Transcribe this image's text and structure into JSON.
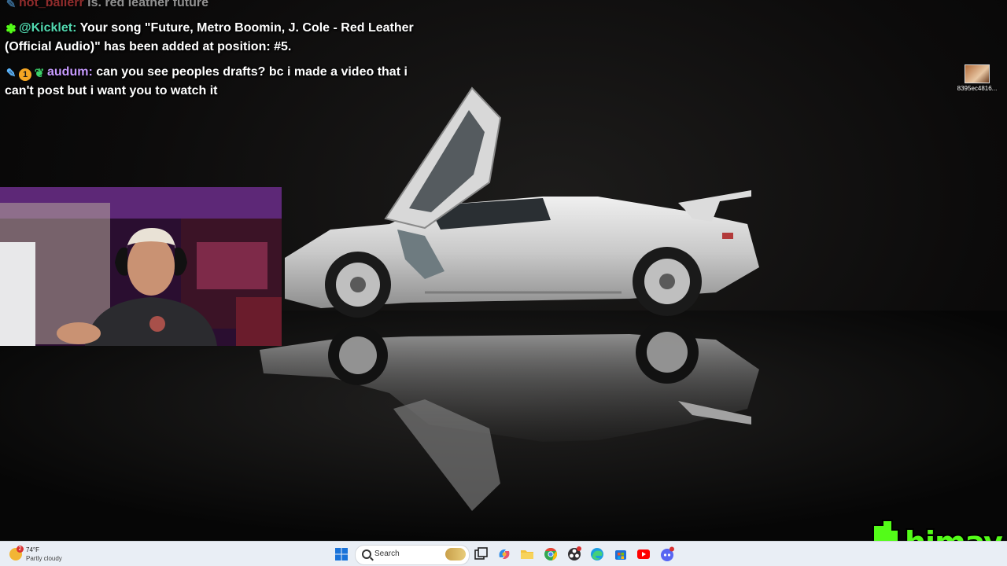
{
  "chat": {
    "messages": [
      {
        "user": "hot_ballerr",
        "text": "is. red leather future"
      },
      {
        "user": "@Kicklet:",
        "text": "Your song \"Future, Metro Boomin, J. Cole - Red Leather (Official Audio)\" has been added at position: #5."
      },
      {
        "user": "audum:",
        "text": "can you see peoples drafts? bc i made a video that i can't post but i want you to watch it"
      }
    ]
  },
  "desktop": {
    "icon_label": "8395ec4816..."
  },
  "taskbar": {
    "weather_temp": "74°F",
    "weather_condition": "Partly cloudy",
    "weather_alert_count": "2",
    "search_placeholder": "Search",
    "icons": [
      "windows-start-icon",
      "task-view-icon",
      "copilot-icon",
      "file-explorer-icon",
      "chrome-icon",
      "obs-icon",
      "edge-icon",
      "microsoft-store-icon",
      "youtube-icon",
      "discord-icon"
    ]
  },
  "overlay": {
    "logo_text": "himay"
  },
  "colors": {
    "kick_green": "#53fc18",
    "taskbar_bg": "#e9eef5",
    "webcam_purple": "#4a1a5c"
  }
}
